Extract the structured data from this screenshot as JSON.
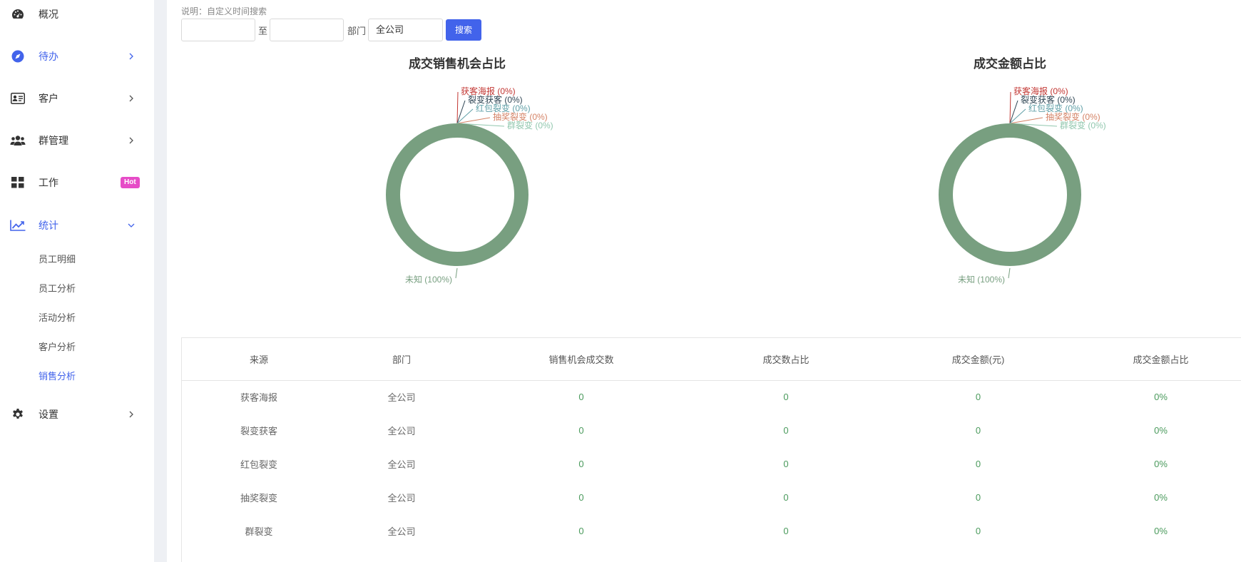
{
  "sidebar": {
    "items": [
      {
        "label": "概况",
        "icon": "dashboard-icon",
        "has_arrow": false,
        "active": false
      },
      {
        "label": "待办",
        "icon": "compass-icon",
        "has_arrow": true,
        "active": true
      },
      {
        "label": "客户",
        "icon": "contact-card-icon",
        "has_arrow": true,
        "active": false
      },
      {
        "label": "群管理",
        "icon": "users-icon",
        "has_arrow": true,
        "active": false
      },
      {
        "label": "工作",
        "icon": "grid-icon",
        "has_arrow": false,
        "badge": "Hot",
        "active": false
      },
      {
        "label": "统计",
        "icon": "trend-chart-icon",
        "has_arrow": true,
        "expanded": true,
        "active": true
      },
      {
        "label": "设置",
        "icon": "gear-icon",
        "has_arrow": true,
        "active": false
      }
    ],
    "stats_sub_items": [
      {
        "label": "员工明细",
        "active": false
      },
      {
        "label": "员工分析",
        "active": false
      },
      {
        "label": "活动分析",
        "active": false
      },
      {
        "label": "客户分析",
        "active": false
      },
      {
        "label": "销售分析",
        "active": true
      }
    ]
  },
  "filter": {
    "hint": "说明：自定义时间搜索",
    "start_date": "",
    "to_label": "至",
    "end_date": "",
    "dept_label": "部门",
    "dept_value": "全公司",
    "search_label": "搜索"
  },
  "colors": {
    "accent": "#4263eb",
    "donut_main": "#789f80",
    "hot_badge": "#e64cc7",
    "label_colors": [
      "#c23531",
      "#2f4554",
      "#61a0a8",
      "#d48265",
      "#91c7ae",
      "#789f80"
    ]
  },
  "chart_data": [
    {
      "type": "pie",
      "donut": true,
      "title": "成交销售机会占比",
      "slices": [
        {
          "name": "获客海报",
          "value": 0,
          "label": "获客海报 (0%)"
        },
        {
          "name": "裂变获客",
          "value": 0,
          "label": "裂变获客 (0%)"
        },
        {
          "name": "红包裂变",
          "value": 0,
          "label": "红包裂变 (0%)"
        },
        {
          "name": "抽奖裂变",
          "value": 0,
          "label": "抽奖裂变 (0%)"
        },
        {
          "name": "群裂变",
          "value": 0,
          "label": "群裂变 (0%)"
        },
        {
          "name": "未知",
          "value": 100,
          "label": "未知 (100%)"
        }
      ]
    },
    {
      "type": "pie",
      "donut": true,
      "title": "成交金额占比",
      "slices": [
        {
          "name": "获客海报",
          "value": 0,
          "label": "获客海报 (0%)"
        },
        {
          "name": "裂变获客",
          "value": 0,
          "label": "裂变获客 (0%)"
        },
        {
          "name": "红包裂变",
          "value": 0,
          "label": "红包裂变 (0%)"
        },
        {
          "name": "抽奖裂变",
          "value": 0,
          "label": "抽奖裂变 (0%)"
        },
        {
          "name": "群裂变",
          "value": 0,
          "label": "群裂变 (0%)"
        },
        {
          "name": "未知",
          "value": 100,
          "label": "未知 (100%)"
        }
      ]
    }
  ],
  "table": {
    "headers": [
      "来源",
      "部门",
      "销售机会成交数",
      "成交数占比",
      "成交金额(元)",
      "成交金额占比"
    ],
    "rows": [
      [
        "获客海报",
        "全公司",
        "0",
        "0",
        "0",
        "0%"
      ],
      [
        "裂变获客",
        "全公司",
        "0",
        "0",
        "0",
        "0%"
      ],
      [
        "红包裂变",
        "全公司",
        "0",
        "0",
        "0",
        "0%"
      ],
      [
        "抽奖裂变",
        "全公司",
        "0",
        "0",
        "0",
        "0%"
      ],
      [
        "群裂变",
        "全公司",
        "0",
        "0",
        "0",
        "0%"
      ]
    ]
  }
}
